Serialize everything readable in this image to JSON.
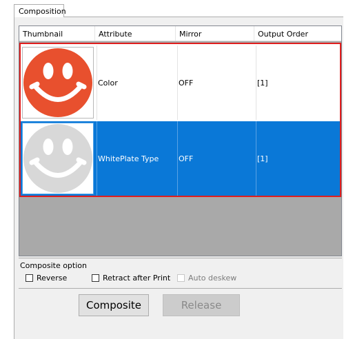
{
  "tab": {
    "label": "Composition"
  },
  "table": {
    "columns": [
      "Thumbnail",
      "Attribute",
      "Mirror",
      "Output Order"
    ],
    "rows": [
      {
        "attribute": "Color",
        "mirror": "OFF",
        "output_order": "[1]",
        "thumbnail_icon": "smiley-face-red",
        "selected": false
      },
      {
        "attribute": "WhitePlate Type",
        "mirror": "OFF",
        "output_order": "[1]",
        "thumbnail_icon": "smiley-face-gray",
        "selected": true
      }
    ]
  },
  "composite_option": {
    "title": "Composite option",
    "reverse": "Reverse",
    "retract": "Retract after Print",
    "auto_deskew": "Auto deskew"
  },
  "buttons": {
    "composite": "Composite",
    "release": "Release"
  },
  "colors": {
    "highlight": "#0a78d7",
    "frame_border": "#e01e1e",
    "smiley_red": "#e8502e",
    "smiley_gray": "#d8d8d8"
  }
}
